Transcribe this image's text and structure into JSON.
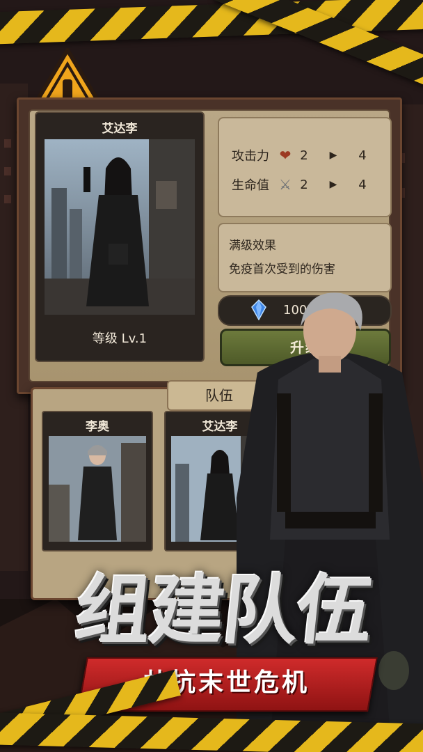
{
  "hero_card": {
    "name": "艾达李",
    "level": "等级 Lv.1"
  },
  "stats": [
    {
      "label": "攻击力",
      "icon": "heart-icon",
      "current": "2",
      "next": "4"
    },
    {
      "label": "生命值",
      "icon": "sword-icon",
      "current": "2",
      "next": "4"
    }
  ],
  "effect": {
    "title": "满级效果",
    "description": "免疫首次受到的伤害"
  },
  "cost": {
    "icon": "blue-crystal-icon",
    "value": "100"
  },
  "upgrade_button": "升级",
  "team": {
    "tab_label": "队伍",
    "members": [
      {
        "name": "李奥"
      },
      {
        "name": "艾达李"
      }
    ]
  },
  "headline": "组建队伍",
  "subheadline": "共抗末世危机",
  "colors": {
    "hazard_yellow": "#e5b81c",
    "panel_brown": "#4a3228",
    "banner_red": "#cf2b2b",
    "upgrade_green": "#5e6b32"
  }
}
